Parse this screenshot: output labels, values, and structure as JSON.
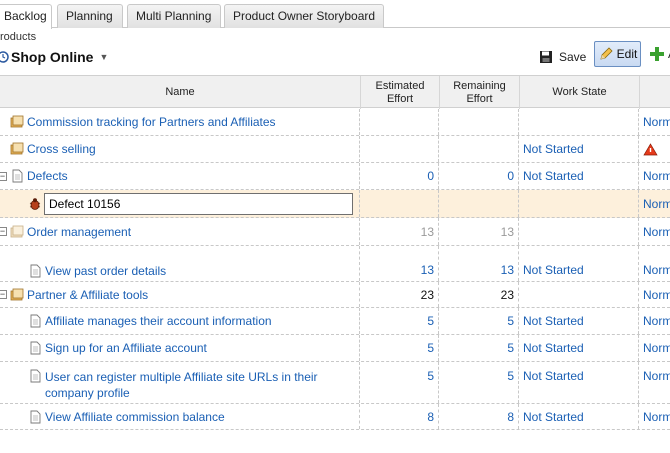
{
  "tabs": [
    {
      "label": "Backlog"
    },
    {
      "label": "Planning"
    },
    {
      "label": "Multi Planning"
    },
    {
      "label": "Product Owner Storyboard"
    }
  ],
  "breadcrumb": "roducts",
  "project": {
    "title": "Shop Online"
  },
  "toolbar": {
    "save_label": "Save",
    "edit_label": "Edit",
    "add_label": "A"
  },
  "columns": {
    "name": "Name",
    "estimated": "Estimated Effort",
    "remaining": "Remaining Effort",
    "work_state": "Work State"
  },
  "rows": [
    {
      "name": "Commission tracking for Partners and Affiliates",
      "estimated": "",
      "remaining": "",
      "state": "",
      "last": "Norm"
    },
    {
      "name": "Cross selling",
      "estimated": "",
      "remaining": "",
      "state": "Not Started",
      "last": ""
    },
    {
      "name": "Defects",
      "estimated": "0",
      "remaining": "0",
      "state": "Not Started",
      "last": "Norm"
    },
    {
      "name": "Defect 10156",
      "estimated": "",
      "remaining": "",
      "state": "",
      "last": "Norm"
    },
    {
      "name": "Order management",
      "estimated": "13",
      "remaining": "13",
      "state": "",
      "last": "Norm"
    },
    {
      "name": "View past order details",
      "estimated": "13",
      "remaining": "13",
      "state": "Not Started",
      "last": "Norm"
    },
    {
      "name": "Partner & Affiliate tools",
      "estimated": "23",
      "remaining": "23",
      "state": "",
      "last": "Norm"
    },
    {
      "name": "Affiliate manages their account information",
      "estimated": "5",
      "remaining": "5",
      "state": "Not Started",
      "last": "Norm"
    },
    {
      "name": "Sign up for an Affiliate account",
      "estimated": "5",
      "remaining": "5",
      "state": "Not Started",
      "last": "Norm"
    },
    {
      "name_line1": "User can register multiple Affiliate site URLs in their",
      "name_line2": "company profile",
      "estimated": "5",
      "remaining": "5",
      "state": "Not Started",
      "last": "Norm"
    },
    {
      "name": "View Affiliate commission balance",
      "estimated": "8",
      "remaining": "8",
      "state": "Not Started",
      "last": "Norm"
    }
  ],
  "icons": {
    "epic": "folder-story-icon",
    "story": "document-icon",
    "defect": "bug-icon",
    "risk": "warning-triangle-icon"
  },
  "colors": {
    "link": "#1a5fb4",
    "selected_row": "#fdf0dc",
    "edit_button": "#c9daf2"
  }
}
